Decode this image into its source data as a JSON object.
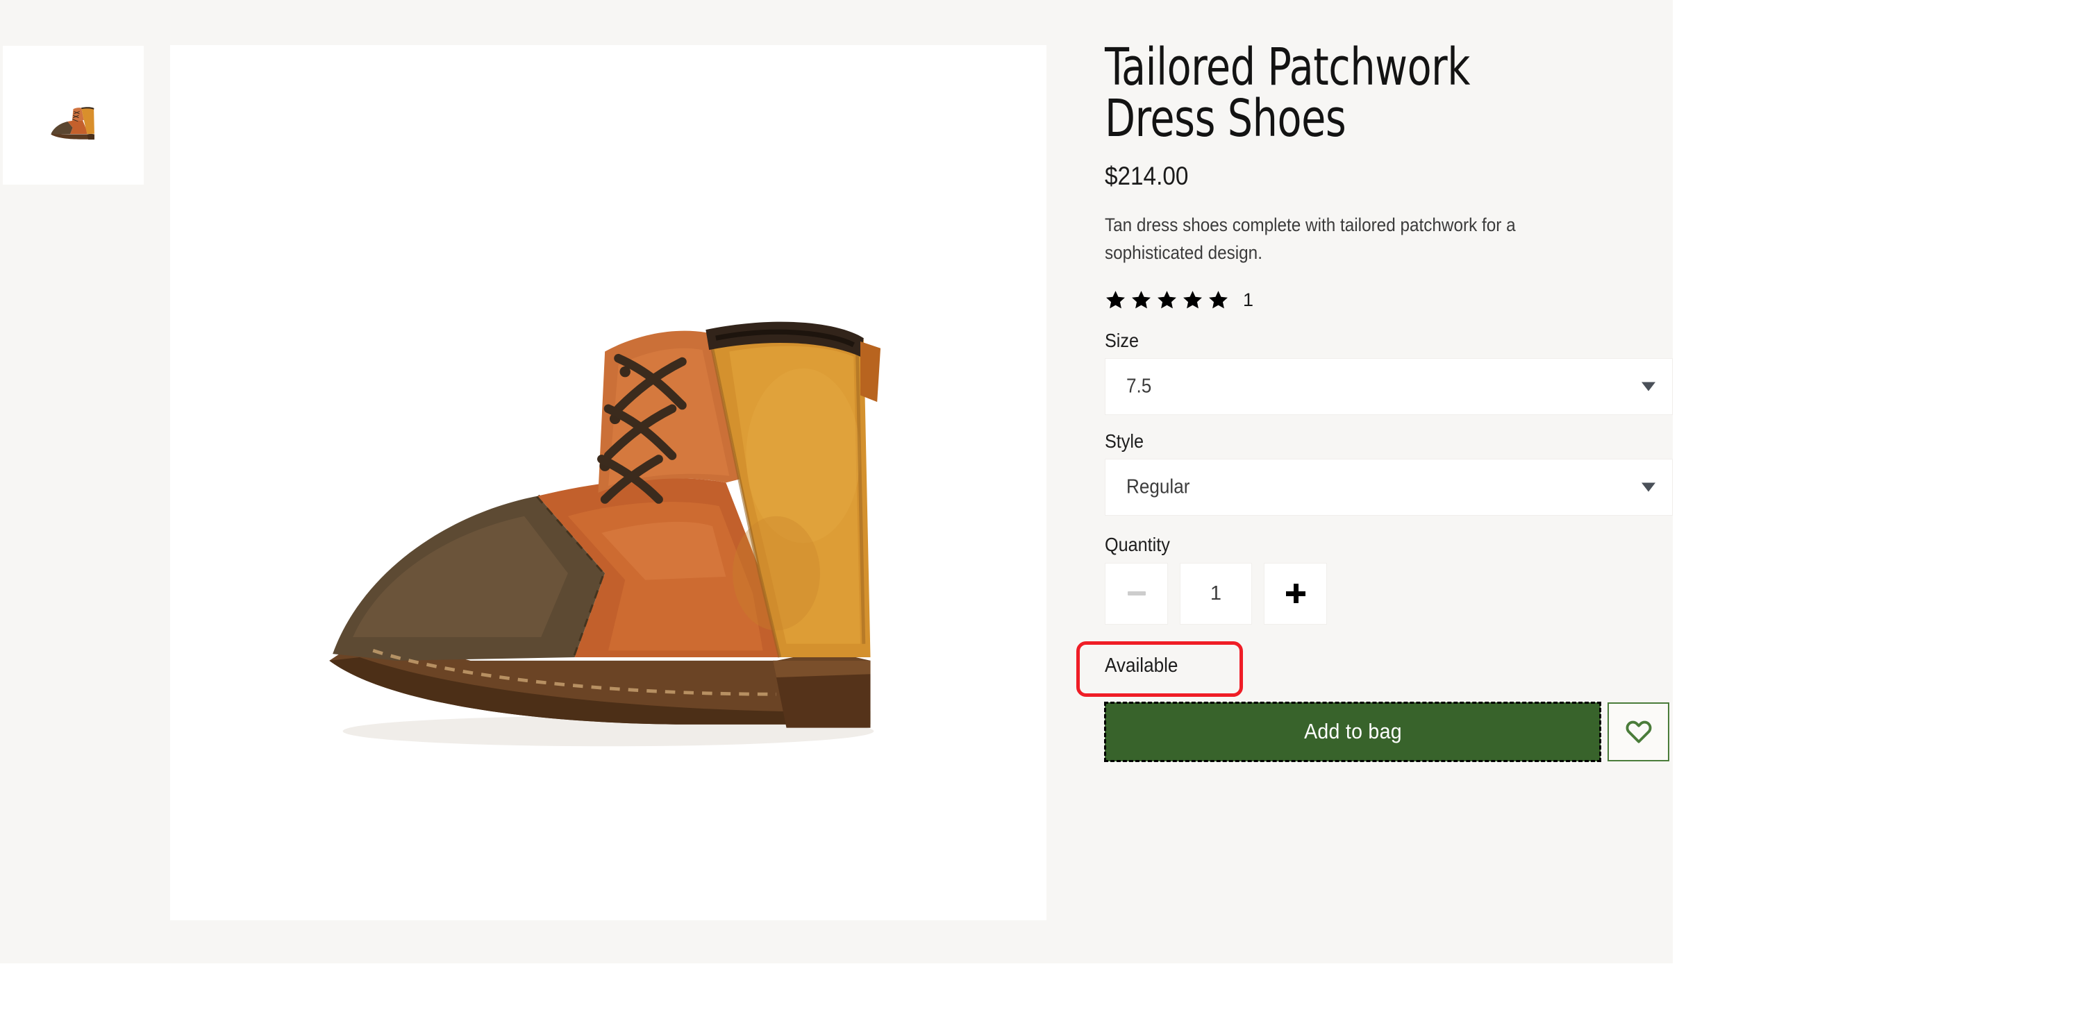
{
  "page": {
    "background_color": "#f7f6f4",
    "outer_background_color": "#ffffff"
  },
  "gallery": {
    "thumbnails": [
      {
        "alt": "Tailored Patchwork Dress Shoes thumbnail",
        "selected": true
      }
    ],
    "main_image": {
      "alt": "Tailored Patchwork Dress Shoes - side view of tan, rust and brown patchwork leather lace-up ankle boot"
    }
  },
  "product": {
    "title": "Tailored Patchwork Dress Shoes",
    "price": "$214.00",
    "description": "Tan dress shoes complete with tailored patchwork for a sophisticated design.",
    "rating": {
      "stars_filled": 5,
      "stars_total": 5,
      "review_count": "1"
    }
  },
  "options": {
    "size": {
      "label": "Size",
      "value": "7.5",
      "chevron_icon": "chevron-down-icon"
    },
    "style": {
      "label": "Style",
      "value": "Regular",
      "chevron_icon": "chevron-down-icon"
    }
  },
  "quantity": {
    "label": "Quantity",
    "value": "1",
    "decrement_icon": "minus-icon",
    "increment_icon": "plus-icon",
    "decrement_disabled": true
  },
  "availability": {
    "text": "Available",
    "annotation_color": "#ef1d26"
  },
  "actions": {
    "add_to_bag_label": "Add to bag",
    "add_to_bag_color": "#38632b",
    "add_to_bag_focused": true,
    "wishlist_icon": "heart-icon",
    "wishlist_color": "#4a7c3a"
  }
}
